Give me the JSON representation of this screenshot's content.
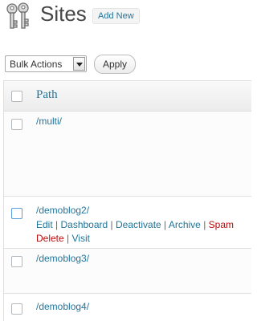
{
  "header": {
    "title": "Sites",
    "add_new_label": "Add New"
  },
  "bulk": {
    "selected": "Bulk Actions",
    "apply_label": "Apply"
  },
  "table": {
    "column_path": "Path",
    "rows": [
      {
        "path": "/multi/"
      },
      {
        "path": "/demoblog2/",
        "actions": {
          "edit": "Edit",
          "dashboard": "Dashboard",
          "deactivate": "Deactivate",
          "archive": "Archive",
          "spam": "Spam",
          "delete": "Delete",
          "visit": "Visit"
        }
      },
      {
        "path": "/demoblog3/"
      },
      {
        "path": "/demoblog4/"
      }
    ],
    "separator": "|"
  },
  "colors": {
    "link": "#21759b",
    "danger": "#bc0b0b",
    "border": "#dfdfdf"
  },
  "icons": {
    "page_icon": "keys-icon",
    "select_arrow": "chevron-down-icon"
  }
}
